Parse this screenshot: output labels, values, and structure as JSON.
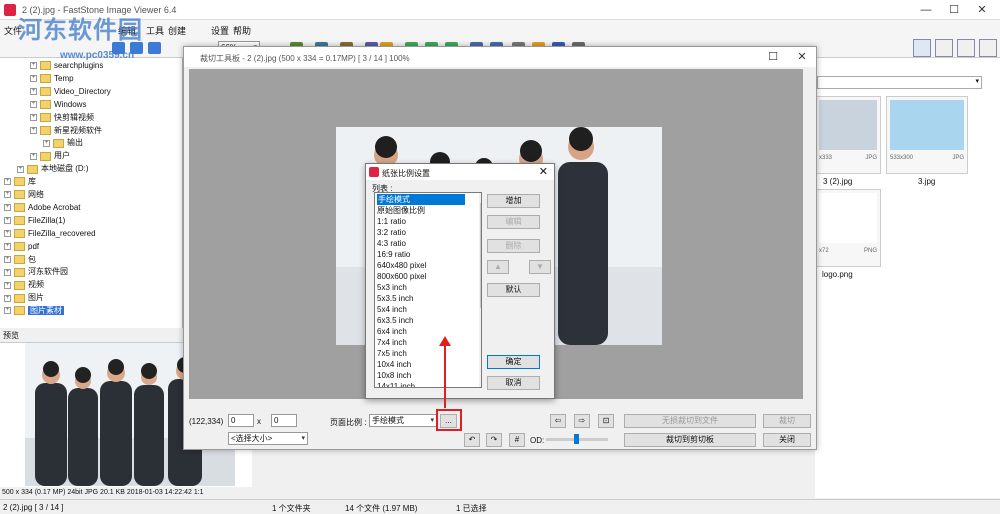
{
  "app": {
    "title": "2 (2).jpg - FastStone Image Viewer 6.4",
    "watermark": "河东软件园",
    "watermark_url": "www.pc0359.cn"
  },
  "menu": [
    "文件",
    "编辑",
    "工具",
    "创建",
    "设置",
    "帮助"
  ],
  "toolbar": {
    "zoom": "66%"
  },
  "tree": {
    "items": [
      {
        "label": "searchplugins",
        "indent": 2
      },
      {
        "label": "Temp",
        "indent": 2
      },
      {
        "label": "Video_Directory",
        "indent": 2
      },
      {
        "label": "Windows",
        "indent": 2
      },
      {
        "label": "快剪辑视频",
        "indent": 2
      },
      {
        "label": "新星视频软件",
        "indent": 2
      },
      {
        "label": "输出",
        "indent": 3
      },
      {
        "label": "用户",
        "indent": 2
      },
      {
        "label": "本地磁盘 (D:)",
        "indent": 1
      },
      {
        "label": "库",
        "indent": 0
      },
      {
        "label": "网络",
        "indent": 0
      },
      {
        "label": "Adobe Acrobat",
        "indent": 0
      },
      {
        "label": "FileZilla(1)",
        "indent": 0
      },
      {
        "label": "FileZilla_recovered",
        "indent": 0
      },
      {
        "label": "pdf",
        "indent": 0
      },
      {
        "label": "包",
        "indent": 0
      },
      {
        "label": "河东软件园",
        "indent": 0
      },
      {
        "label": "视频",
        "indent": 0
      },
      {
        "label": "图片",
        "indent": 0
      },
      {
        "label": "图片素材",
        "indent": 0,
        "selected": true
      }
    ]
  },
  "preview": {
    "header": "预览"
  },
  "status_left": "500 x 334 (0.17 MP)  24bit  JPG  20.1 KB  2018-01-03 14:22:42  1:1",
  "statusbar": {
    "file": "2 (2).jpg [ 3 / 14 ]",
    "folders": "1 个文件夹",
    "files": "14 个文件 (1.97 MB)",
    "selected": "1 已选择"
  },
  "thumbs": [
    {
      "dim": "x333",
      "fmt": "JPG",
      "name": "3 (2).jpg"
    },
    {
      "dim": "533x300",
      "fmt": "JPG",
      "name": "3.jpg"
    },
    {
      "dim": "x72",
      "fmt": "PNG",
      "name": "logo.png"
    }
  ],
  "crop": {
    "title": "裁切工具板 - 2 (2).jpg  (500 x 334 = 0.17MP)  [ 3 / 14 ]   100%",
    "coords": "(122,334)",
    "spin_x": "0",
    "spin_y": "0",
    "size_select": "<选择大小>",
    "ratio_label": "页面比例 :",
    "ratio_value": "手绘模式",
    "browse": "...",
    "btn_lossless": "无损裁切到文件",
    "btn_crop": "裁切",
    "btn_crop_clip": "裁切到剪切板",
    "btn_close": "关闭",
    "od_label": "OD:"
  },
  "dialog": {
    "title": "纸张比例设置",
    "list_label": "列表 :",
    "items": [
      "手绘模式",
      "原始图像比例",
      "1:1 ratio",
      "3:2 ratio",
      "4:3 ratio",
      "16:9 ratio",
      "640x480 pixel",
      "800x600 pixel",
      "5x3 inch",
      "5x3.5 inch",
      "5x4 inch",
      "6x3.5 inch",
      "6x4 inch",
      "7x4 inch",
      "7x5 inch",
      "10x4 inch",
      "10x8 inch",
      "14x11 inch"
    ],
    "btn_add": "增加",
    "btn_edit": "编辑",
    "btn_delete": "删除",
    "btn_up": "▲",
    "btn_down": "▼",
    "btn_default": "默认",
    "btn_ok": "确定",
    "btn_cancel": "取消"
  },
  "colors": {
    "accent": "#0078d7",
    "highlight": "#e02020",
    "tree_selected": "#3370d8"
  }
}
